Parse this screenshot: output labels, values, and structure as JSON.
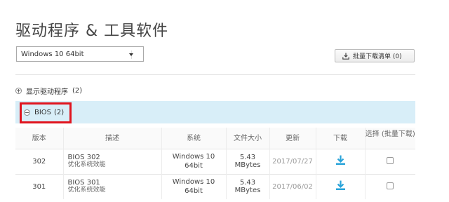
{
  "page": {
    "title": "驱动程序 & 工具软件"
  },
  "os_select": {
    "value": "Windows 10 64bit"
  },
  "batch_button": {
    "label": "批量下载清单 (0)"
  },
  "sections": [
    {
      "label": "显示驱动程序",
      "count": "(2)",
      "expanded": false
    },
    {
      "label": "BIOS",
      "count": "(2)",
      "expanded": true
    }
  ],
  "table": {
    "headers": [
      "版本",
      "描述",
      "系统",
      "文件大小",
      "更新",
      "下载",
      "选择 (批量下载)"
    ],
    "rows": [
      {
        "version": "302",
        "desc_title": "BIOS 302",
        "desc_sub": "优化系统效能",
        "system_1": "Windows 10",
        "system_2": "64bit",
        "size": "5.43 MBytes",
        "date": "2017/07/27"
      },
      {
        "version": "301",
        "desc_title": "BIOS 301",
        "desc_sub": "优化系统效能",
        "system_1": "Windows 10",
        "system_2": "64bit",
        "size": "5.43 MBytes",
        "date": "2017/06/02"
      }
    ]
  },
  "colors": {
    "accent": "#29a3d9",
    "highlight": "#e0141e",
    "band": "#d8eef8"
  },
  "icons": {
    "download": "download-icon",
    "batch": "download-tray-icon"
  }
}
